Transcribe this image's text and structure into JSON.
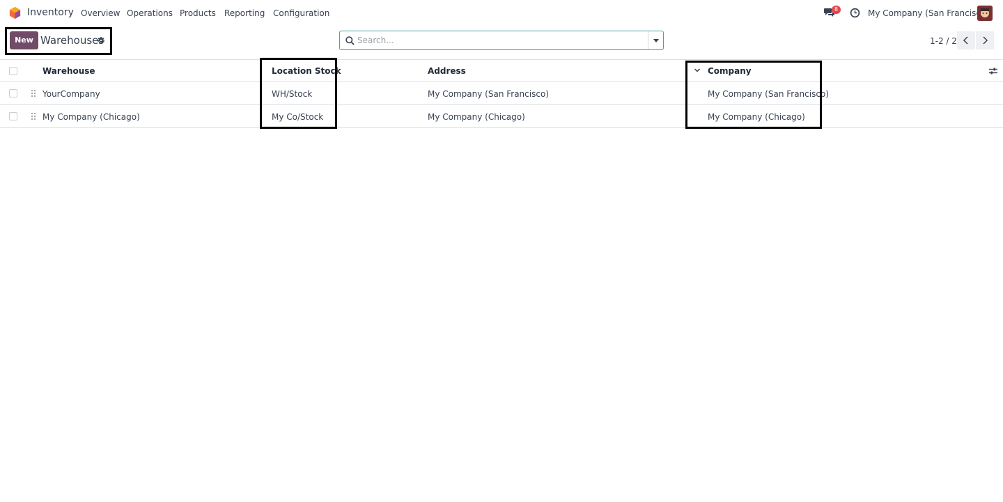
{
  "navbar": {
    "app_name": "Inventory",
    "menu": [
      "Overview",
      "Operations",
      "Products",
      "Reporting",
      "Configuration"
    ],
    "message_count": "8",
    "company": "My Company (San Francisco)"
  },
  "control_panel": {
    "new_label": "New",
    "title": "Warehouses",
    "search_placeholder": "Search...",
    "pager": "1-2 / 2"
  },
  "table": {
    "columns": [
      "Warehouse",
      "Location Stock",
      "Address",
      "Company"
    ],
    "rows": [
      {
        "warehouse": "YourCompany",
        "location_stock": "WH/Stock",
        "address": "My Company (San Francisco)",
        "company": "My Company (San Francisco)"
      },
      {
        "warehouse": "My Company (Chicago)",
        "location_stock": "My Co/Stock",
        "address": "My Company (Chicago)",
        "company": "My Company (Chicago)"
      }
    ]
  },
  "colors": {
    "accent": "#714b67",
    "badge": "#e4474e",
    "search_border": "#4aa0a2"
  }
}
